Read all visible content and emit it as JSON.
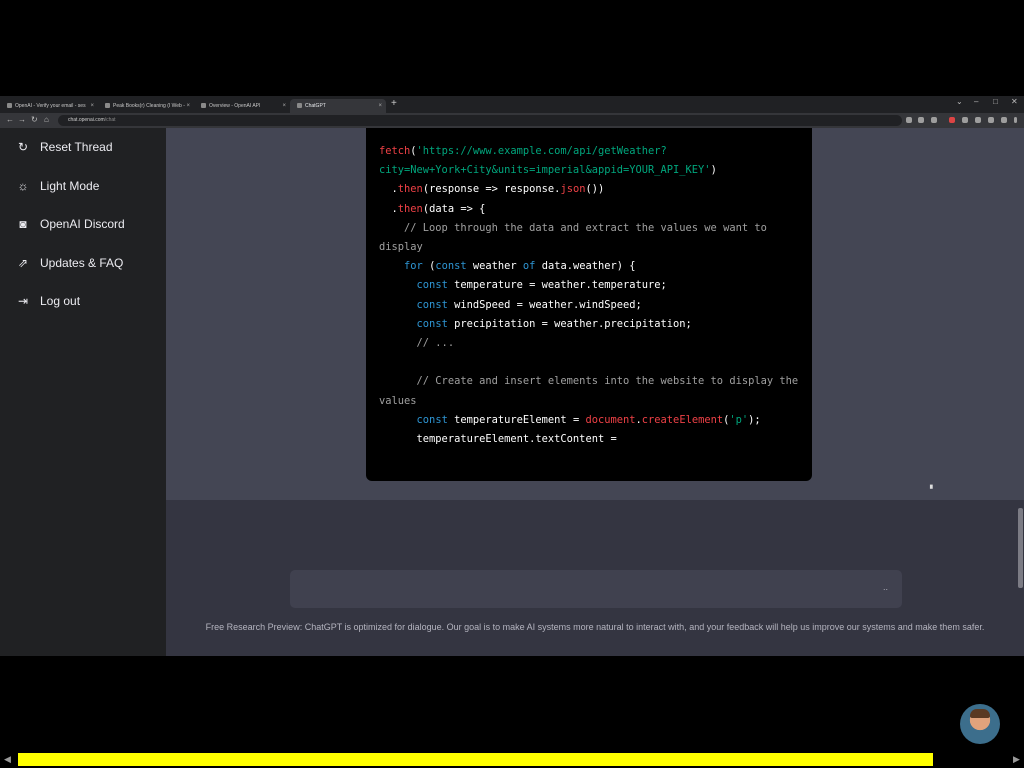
{
  "browser": {
    "tabs": [
      {
        "label": "OpenAI - Verify your email - ses"
      },
      {
        "label": "Peak Books(r) Cleaning (I Web -"
      },
      {
        "label": "Overview - OpenAI API"
      },
      {
        "label": "ChatGPT"
      }
    ],
    "new_tab": "+",
    "window_controls": {
      "minimize": "–",
      "maximize": "□",
      "close": "✕",
      "dropdown": "⌄"
    },
    "nav": {
      "back": "←",
      "forward": "→",
      "reload": "↻",
      "home": "⌂"
    },
    "url": {
      "host": "chat.openai.com",
      "path": "/chat"
    }
  },
  "sidebar": {
    "items": [
      {
        "icon": "refresh-icon",
        "glyph": "↻",
        "label": "Reset Thread"
      },
      {
        "icon": "sun-icon",
        "glyph": "☼",
        "label": "Light Mode"
      },
      {
        "icon": "discord-icon",
        "glyph": "◙",
        "label": "OpenAI Discord"
      },
      {
        "icon": "external-link-icon",
        "glyph": "⇗",
        "label": "Updates & FAQ"
      },
      {
        "icon": "logout-icon",
        "glyph": "⇥",
        "label": "Log out"
      }
    ]
  },
  "code": {
    "lines": [
      [
        {
          "c": "fn",
          "t": "fetch"
        },
        {
          "t": "("
        },
        {
          "c": "str",
          "t": "'https://www.example.com/api/getWeather?"
        }
      ],
      [
        {
          "c": "str",
          "t": "city=New+York+City&units=imperial&appid=YOUR_API_KEY'"
        },
        {
          "t": ")"
        }
      ],
      [
        {
          "t": "  ."
        },
        {
          "c": "fn",
          "t": "then"
        },
        {
          "t": "(response => response."
        },
        {
          "c": "fn",
          "t": "json"
        },
        {
          "t": "())"
        }
      ],
      [
        {
          "t": "  ."
        },
        {
          "c": "fn",
          "t": "then"
        },
        {
          "t": "(data => {"
        }
      ],
      [
        {
          "c": "cm",
          "t": "    // Loop through the data and extract the values we want to"
        }
      ],
      [
        {
          "c": "cm",
          "t": "display"
        }
      ],
      [
        {
          "t": "    "
        },
        {
          "c": "kw",
          "t": "for"
        },
        {
          "t": " ("
        },
        {
          "c": "kw",
          "t": "const"
        },
        {
          "t": " weather "
        },
        {
          "c": "kw",
          "t": "of"
        },
        {
          "t": " data.weather) {"
        }
      ],
      [
        {
          "t": "      "
        },
        {
          "c": "kw",
          "t": "const"
        },
        {
          "t": " temperature = weather.temperature;"
        }
      ],
      [
        {
          "t": "      "
        },
        {
          "c": "kw",
          "t": "const"
        },
        {
          "t": " windSpeed = weather.windSpeed;"
        }
      ],
      [
        {
          "t": "      "
        },
        {
          "c": "kw",
          "t": "const"
        },
        {
          "t": " precipitation = weather.precipitation;"
        }
      ],
      [
        {
          "c": "cm",
          "t": "      // ..."
        }
      ],
      [
        {
          "t": ""
        }
      ],
      [
        {
          "c": "cm",
          "t": "      // Create and insert elements into the website to display the"
        }
      ],
      [
        {
          "c": "cm",
          "t": "values"
        }
      ],
      [
        {
          "t": "      "
        },
        {
          "c": "kw",
          "t": "const"
        },
        {
          "t": " temperatureElement = "
        },
        {
          "c": "fn",
          "t": "document"
        },
        {
          "t": "."
        },
        {
          "c": "fn",
          "t": "createElement"
        },
        {
          "t": "("
        },
        {
          "c": "str",
          "t": "'p'"
        },
        {
          "t": ");"
        }
      ],
      [
        {
          "t": "      temperatureElement.textContent ="
        }
      ]
    ]
  },
  "input": {
    "send_glyph": ".."
  },
  "footer": {
    "text": "Free Research Preview: ChatGPT is optimized for dialogue. Our goal is to make AI systems more natural to interact with, and your feedback will help us improve our systems and make them safer."
  },
  "player": {
    "progress": 0.91,
    "left_arrow": "◀",
    "right_arrow": "▶"
  },
  "colors": {
    "sidebar": "#202123",
    "answer": "#444654",
    "main": "#343541",
    "code_bg": "#000000",
    "fn": "#ef4146",
    "str": "#00a67d",
    "kw": "#2e95d3",
    "progress": "#ffff00"
  }
}
